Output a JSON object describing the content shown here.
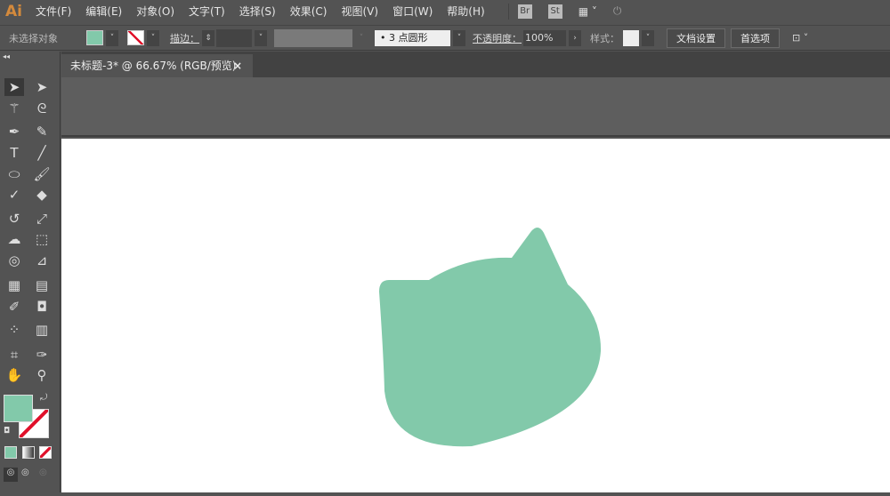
{
  "app": {
    "logo": "Ai"
  },
  "menu": [
    "文件(F)",
    "编辑(E)",
    "对象(O)",
    "文字(T)",
    "选择(S)",
    "效果(C)",
    "视图(V)",
    "窗口(W)",
    "帮助(H)"
  ],
  "app_icons": {
    "bridge": "Br",
    "stock": "St"
  },
  "control": {
    "selection": "未选择对象",
    "fill_color": "#82C9AA",
    "stroke": "none",
    "stroke_label": "描边：",
    "brush": "3 点圆形",
    "opacity_label": "不透明度：",
    "opacity": "100%",
    "style_label": "样式：",
    "doc_setup": "文档设置",
    "prefs": "首选项"
  },
  "tab": {
    "title": "未标题-3* @ 66.67% (RGB/预览)",
    "close": "×"
  },
  "tools": [
    "selection",
    "direct-selection",
    "magic-wand",
    "lasso",
    "pen",
    "curvature",
    "type",
    "line",
    "ellipse",
    "paintbrush",
    "shaper",
    "eraser",
    "rotate",
    "scale",
    "warp",
    "free-transform",
    "shape-builder",
    "perspective-grid",
    "mesh",
    "gradient",
    "eyedropper",
    "blend",
    "symbol-sprayer",
    "column-graph",
    "artboard",
    "slice",
    "hand",
    "zoom"
  ],
  "colors": {
    "fill": "#82C9AA",
    "shape": "#82C9AA"
  }
}
